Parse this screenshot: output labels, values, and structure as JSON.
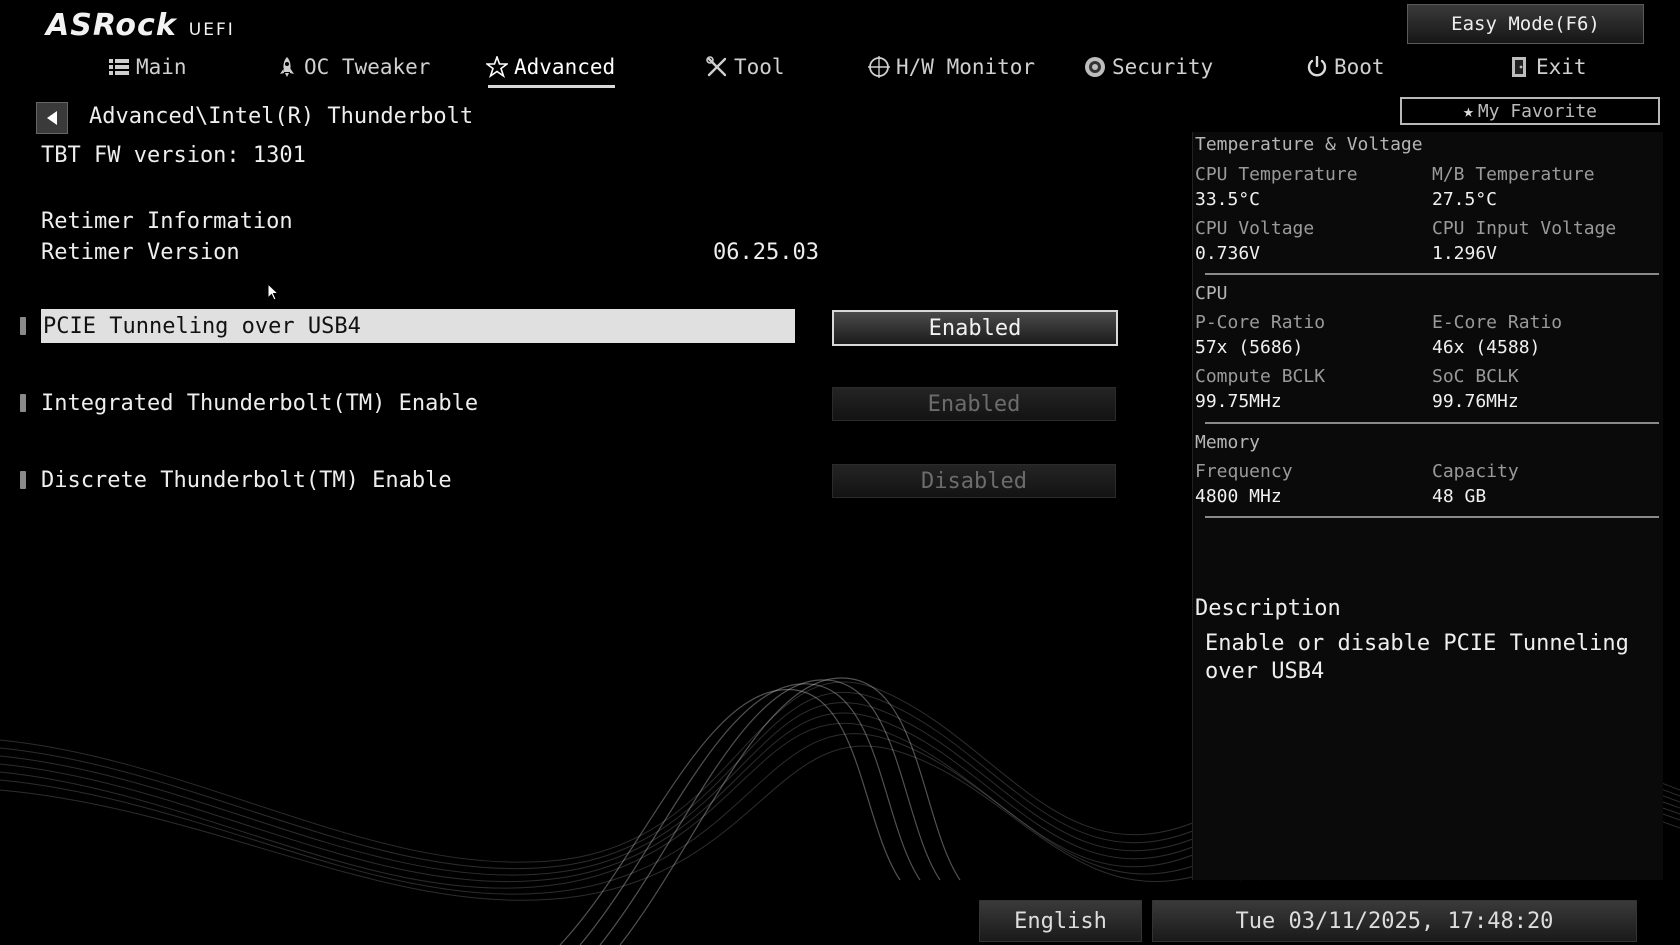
{
  "header": {
    "brand": "ASRock",
    "uefi": "UEFI",
    "easy_mode": "Easy Mode(F6)"
  },
  "nav": {
    "tabs": [
      {
        "label": "Main",
        "icon": "list-icon"
      },
      {
        "label": "OC Tweaker",
        "icon": "rocket-icon"
      },
      {
        "label": "Advanced",
        "icon": "star-icon",
        "active": true
      },
      {
        "label": "Tool",
        "icon": "tools-icon"
      },
      {
        "label": "H/W Monitor",
        "icon": "monitor-icon"
      },
      {
        "label": "Security",
        "icon": "shield-icon"
      },
      {
        "label": "Boot",
        "icon": "power-icon"
      },
      {
        "label": "Exit",
        "icon": "exit-door-icon"
      }
    ]
  },
  "page": {
    "breadcrumb": "Advanced\\Intel(R) Thunderbolt",
    "fw_version": "TBT FW version: 1301",
    "retimer_info": "Retimer Information",
    "retimer_version_label": "Retimer Version",
    "retimer_version_value": "06.25.03"
  },
  "settings": [
    {
      "label": "PCIE Tunneling over USB4",
      "value": "Enabled",
      "selected": true
    },
    {
      "label": "Integrated Thunderbolt(TM) Enable",
      "value": "Enabled",
      "selected": false
    },
    {
      "label": "Discrete Thunderbolt(TM) Enable",
      "value": "Disabled",
      "selected": false
    }
  ],
  "sidebar": {
    "favorite": "My Favorite",
    "temp_voltage": {
      "title": "Temperature & Voltage",
      "cpu_temp_label": "CPU Temperature",
      "cpu_temp": "33.5°C",
      "mb_temp_label": "M/B Temperature",
      "mb_temp": "27.5°C",
      "cpu_volt_label": "CPU Voltage",
      "cpu_volt": "0.736V",
      "cpu_input_volt_label": "CPU Input Voltage",
      "cpu_input_volt": "1.296V"
    },
    "cpu": {
      "title": "CPU",
      "pcore_label": "P-Core Ratio",
      "pcore": "57x (5686)",
      "ecore_label": "E-Core Ratio",
      "ecore": "46x (4588)",
      "compute_bclk_label": "Compute BCLK",
      "compute_bclk": "99.75MHz",
      "soc_bclk_label": "SoC BCLK",
      "soc_bclk": "99.76MHz"
    },
    "memory": {
      "title": "Memory",
      "freq_label": "Frequency",
      "freq": "4800 MHz",
      "cap_label": "Capacity",
      "cap": "48 GB"
    },
    "description": {
      "title": "Description",
      "text": "Enable or disable PCIE Tunneling over USB4"
    }
  },
  "footer": {
    "language": "English",
    "datetime": "Tue 03/11/2025, 17:48:20"
  }
}
